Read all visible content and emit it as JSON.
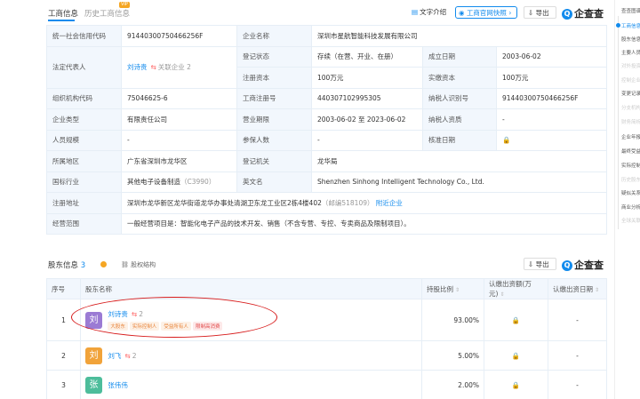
{
  "tabs": {
    "business": "工商信息",
    "history": "历史工商信息",
    "vip": "VIP"
  },
  "toolbar": {
    "text_intro": "文字介绍",
    "official_mark": "工商官网快照",
    "export": "导出",
    "logo": "企查查",
    "logo_mark": "Q"
  },
  "info": {
    "credit_code_label": "统一社会信用代码",
    "credit_code": "91440300750466256F",
    "company_name_label": "企业名称",
    "company_name": "深圳市星航智能科技发展有限公司",
    "legal_rep_label": "法定代表人",
    "legal_rep": "刘诗贵",
    "legal_rep_badge": "关联企业 2",
    "reg_status_label": "登记状态",
    "reg_status": "存续（在营、开业、在册）",
    "est_date_label": "成立日期",
    "est_date": "2003-06-02",
    "reg_capital_label": "注册资本",
    "reg_capital": "100万元",
    "paid_capital_label": "实缴资本",
    "paid_capital": "100万元",
    "org_code_label": "组织机构代码",
    "org_code": "75046625-6",
    "biz_reg_no_label": "工商注册号",
    "biz_reg_no": "440307102995305",
    "taxpayer_id_label": "纳税人识别号",
    "taxpayer_id": "91440300750466256F",
    "ent_type_label": "企业类型",
    "ent_type": "有限责任公司",
    "biz_term_label": "营业期限",
    "biz_term": "2003-06-02 至 2023-06-02",
    "taxpayer_qual_label": "纳税人资质",
    "taxpayer_qual": "-",
    "staff_size_label": "人员规模",
    "staff_size": "-",
    "insured_label": "参保人数",
    "insured": "-",
    "approve_date_label": "核准日期",
    "region_label": "所属地区",
    "region": "广东省深圳市龙华区",
    "reg_authority_label": "登记机关",
    "reg_authority": "龙华局",
    "industry_label": "国标行业",
    "industry": "其他电子设备制造",
    "industry_code": "（C3990）",
    "en_name_label": "英文名",
    "en_name": "Shenzhen Sinhong Intelligent Technology Co., Ltd.",
    "address_label": "注册地址",
    "address": "深圳市龙华新区龙华街道龙华办事处清湖卫东龙工业区2栋4楼402",
    "postcode": "（邮编518109）",
    "nearby": "附近企业",
    "scope_label": "经营范围",
    "scope": "一般经营项目是：智能化电子产品的技术开发、销售（不含专营、专控、专卖商品及限制项目）。"
  },
  "shareholders": {
    "title": "股东信息",
    "count": "3",
    "structure": "股权结构",
    "export": "导出",
    "headers": [
      "序号",
      "股东名称",
      "持股比例",
      "认缴出资额(万元)",
      "认缴出资日期"
    ],
    "rows": [
      {
        "no": "1",
        "avatar": "刘",
        "name": "刘诗贵",
        "badge": "2",
        "tags": [
          "大股东",
          "实际控制人",
          "受益所有人",
          "限制高消费"
        ],
        "ratio": "93.00%",
        "amount": "",
        "date": "-"
      },
      {
        "no": "2",
        "avatar": "刘",
        "name": "刘飞",
        "badge": "2",
        "tags": [],
        "ratio": "5.00%",
        "amount": "",
        "date": "-"
      },
      {
        "no": "3",
        "avatar": "张",
        "name": "张伟伟",
        "badge": "",
        "tags": [],
        "ratio": "2.00%",
        "amount": "",
        "date": "-"
      }
    ]
  },
  "sidebar": {
    "items": [
      "查查图谱",
      "工商信息",
      "股东信息",
      "主要人员",
      "对外投资",
      "控制企业",
      "变更记录",
      "分支机构",
      "财务简析",
      "企业年报",
      "最终受益人",
      "实际控制人",
      "历史股东",
      "疑似关系",
      "商业分析",
      "全球关联"
    ]
  },
  "colors": {
    "accent": "#128bed",
    "highlight": "#d71a1a"
  }
}
